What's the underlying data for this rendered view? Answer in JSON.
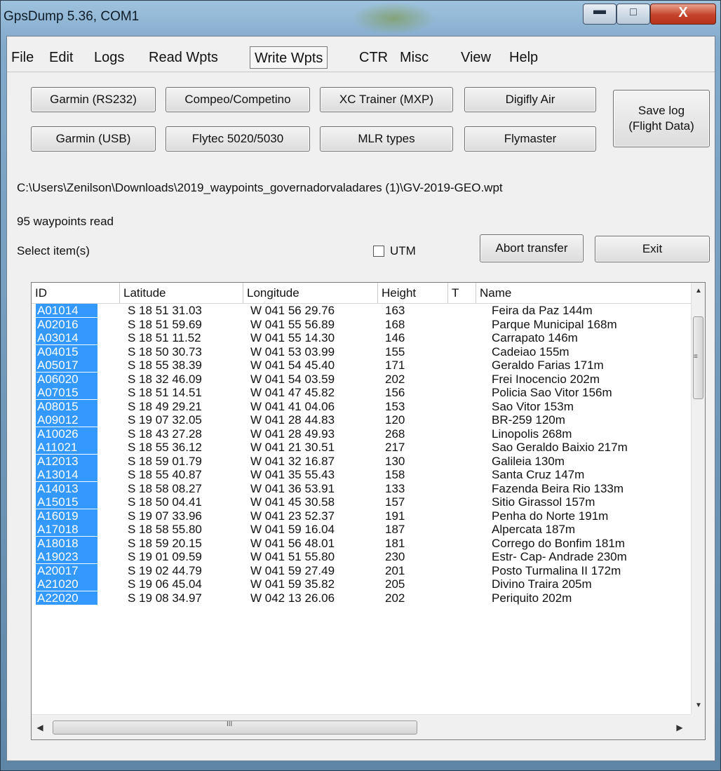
{
  "window": {
    "title": "GpsDump 5.36, COM1",
    "controls": {
      "minimize": "▬",
      "maximize": "□",
      "close": "X"
    }
  },
  "menu": [
    {
      "label": "File"
    },
    {
      "label": "Edit"
    },
    {
      "label": "Logs"
    },
    {
      "label": "Read Wpts"
    },
    {
      "label": "Write Wpts",
      "active": true
    },
    {
      "label": "CTR"
    },
    {
      "label": "Misc"
    },
    {
      "label": "View"
    },
    {
      "label": "Help"
    }
  ],
  "buttons": {
    "garmin_rs232": "Garmin (RS232)",
    "compeo": "Compeo/Competino",
    "xc_trainer": "XC Trainer (MXP)",
    "digifly": "Digifly Air",
    "save_log_line1": "Save log",
    "save_log_line2": "(Flight Data)",
    "garmin_usb": "Garmin (USB)",
    "flytec": "Flytec 5020/5030",
    "mlr": "MLR types",
    "flymaster": "Flymaster",
    "abort": "Abort transfer",
    "exit": "Exit"
  },
  "file_path": "C:\\Users\\Zenilson\\Downloads\\2019_waypoints_governadorvaladares (1)\\GV-2019-GEO.wpt",
  "status": "95 waypoints read",
  "select_label": "Select item(s)",
  "utm_label": "UTM",
  "utm_checked": false,
  "table": {
    "columns": [
      "ID",
      "Latitude",
      "Longitude",
      "Height",
      "T",
      "Name"
    ],
    "rows": [
      {
        "id": "A01014",
        "lat": "S 18  51  31.03",
        "lon": "W 041  56  29.76",
        "height": "163",
        "name": "Feira da Paz 144m"
      },
      {
        "id": "A02016",
        "lat": "S 18  51  59.69",
        "lon": "W 041  55  56.89",
        "height": "168",
        "name": "Parque Municipal 168m"
      },
      {
        "id": "A03014",
        "lat": "S 18  51  11.52",
        "lon": "W 041  55  14.30",
        "height": "146",
        "name": "Carrapato 146m"
      },
      {
        "id": "A04015",
        "lat": "S 18  50  30.73",
        "lon": "W 041  53  03.99",
        "height": "155",
        "name": "Cadeiao 155m"
      },
      {
        "id": "A05017",
        "lat": "S 18  55  38.39",
        "lon": "W 041  54  45.40",
        "height": "171",
        "name": "Geraldo Farias 171m"
      },
      {
        "id": "A06020",
        "lat": "S 18  32  46.09",
        "lon": "W 041  54  03.59",
        "height": "202",
        "name": "Frei Inocencio 202m"
      },
      {
        "id": "A07015",
        "lat": "S 18  51  14.51",
        "lon": "W 041  47  45.82",
        "height": "156",
        "name": "Policia Sao Vitor 156m"
      },
      {
        "id": "A08015",
        "lat": "S 18  49  29.21",
        "lon": "W 041  41  04.06",
        "height": "153",
        "name": "Sao Vitor 153m"
      },
      {
        "id": "A09012",
        "lat": "S 19  07  32.05",
        "lon": "W 041  28  44.83",
        "height": "120",
        "name": "BR-259 120m"
      },
      {
        "id": "A10026",
        "lat": "S 18  43  27.28",
        "lon": "W 041  28  49.93",
        "height": "268",
        "name": "Linopolis 268m"
      },
      {
        "id": "A11021",
        "lat": "S 18  55  36.12",
        "lon": "W 041  21  30.51",
        "height": "217",
        "name": "Sao Geraldo Baixio 217m"
      },
      {
        "id": "A12013",
        "lat": "S 18  59  01.79",
        "lon": "W 041  32  16.87",
        "height": "130",
        "name": "Galileia 130m"
      },
      {
        "id": "A13014",
        "lat": "S 18  55  40.87",
        "lon": "W 041  35  55.43",
        "height": "158",
        "name": "Santa Cruz 147m"
      },
      {
        "id": "A14013",
        "lat": "S 18  58  08.27",
        "lon": "W 041  36  53.91",
        "height": "133",
        "name": "Fazenda Beira Rio 133m"
      },
      {
        "id": "A15015",
        "lat": "S 18  50  04.41",
        "lon": "W 041  45  30.58",
        "height": "157",
        "name": "Sitio Girassol 157m"
      },
      {
        "id": "A16019",
        "lat": "S 19  07  33.96",
        "lon": "W 041  23  52.37",
        "height": "191",
        "name": "Penha do Norte 191m"
      },
      {
        "id": "A17018",
        "lat": "S 18  58  55.80",
        "lon": "W 041  59  16.04",
        "height": "187",
        "name": "Alpercata 187m"
      },
      {
        "id": "A18018",
        "lat": "S 18  59  20.15",
        "lon": "W 041  56  48.01",
        "height": "181",
        "name": "Corrego do Bonfim 181m"
      },
      {
        "id": "A19023",
        "lat": "S 19  01  09.59",
        "lon": "W 041  51  55.80",
        "height": "230",
        "name": "Estr- Cap- Andrade 230m"
      },
      {
        "id": "A20017",
        "lat": "S 19  02  44.79",
        "lon": "W 041  59  27.49",
        "height": "201",
        "name": "Posto Turmalina II 172m"
      },
      {
        "id": "A21020",
        "lat": "S 19  06  45.04",
        "lon": "W 041  59  35.82",
        "height": "205",
        "name": "Divino Traira 205m"
      },
      {
        "id": "A22020",
        "lat": "S 19  08  34.97",
        "lon": "W 042  13  26.06",
        "height": "202",
        "name": "Periquito 202m"
      }
    ]
  },
  "scrollbar": {
    "up": "▲",
    "down": "▼",
    "left": "◀",
    "right": "▶",
    "grip_v": "≡",
    "grip_h": "III"
  },
  "colors": {
    "selection": "#3399ff",
    "close_button": "#c4432a",
    "title_gradient": "#9fc3de"
  }
}
